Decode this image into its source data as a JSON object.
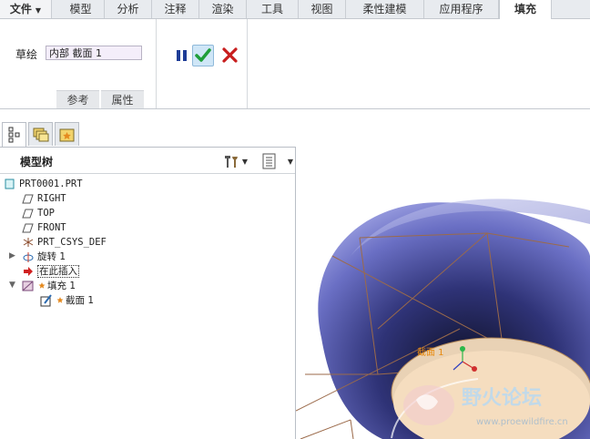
{
  "tabs": {
    "file": "文件",
    "items": [
      "模型",
      "分析",
      "注释",
      "渲染",
      "工具",
      "视图",
      "柔性建模",
      "应用程序"
    ],
    "active": "填充"
  },
  "ribbon": {
    "sketch_label": "草绘",
    "sketch_value": "内部 截面 1",
    "sub_tabs": [
      "参考",
      "属性"
    ]
  },
  "tree": {
    "title": "模型树",
    "items": [
      {
        "label": "PRT0001.PRT"
      },
      {
        "label": "RIGHT"
      },
      {
        "label": "TOP"
      },
      {
        "label": "FRONT"
      },
      {
        "label": "PRT_CSYS_DEF"
      },
      {
        "label": "旋转 1"
      },
      {
        "label": "在此插入"
      },
      {
        "label": "填充 1"
      },
      {
        "label": "截面 1"
      }
    ]
  },
  "viewport": {
    "section_label": "截面 1",
    "watermark": "野火论坛",
    "watermark_url": "www.proewildfire.cn"
  },
  "colors": {
    "ribbon_bg": "#ffffff",
    "tab_bg": "#e8ebef",
    "ok_green": "#1f9e3a",
    "cancel_red": "#c81e1e",
    "pause_blue": "#1e3c96",
    "surface_blue": "#4a4fa8",
    "section_fill": "#f5d9b5",
    "sketch_lines": "#9b6a4a"
  },
  "icons": [
    "pause-icon",
    "check-icon",
    "cancel-icon",
    "model-tree-tab-icon",
    "folder-browser-tab-icon",
    "favorites-tab-icon",
    "settings-icon",
    "show-icon"
  ]
}
